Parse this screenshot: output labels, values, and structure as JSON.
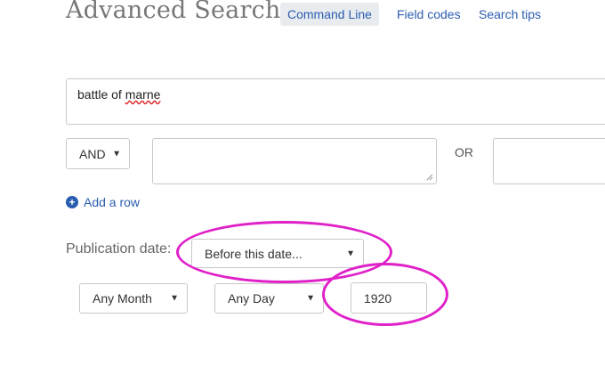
{
  "header": {
    "title": "Advanced Search",
    "tabs": [
      {
        "label": "Command Line",
        "active": true
      },
      {
        "label": "Field codes",
        "active": false
      },
      {
        "label": "Search tips",
        "active": false
      }
    ]
  },
  "query": {
    "row1_text_prefix": "battle of ",
    "row1_text_misspelled": "marne",
    "row2_operator": "AND",
    "row2_value": "",
    "or_label": "OR"
  },
  "add_row_label": "Add a row",
  "publication_date": {
    "label": "Publication date:",
    "mode": "Before this date...",
    "month": "Any Month",
    "day": "Any Day",
    "year": "1920"
  },
  "colors": {
    "accent": "#2a5db0",
    "annotation": "#e020c8"
  },
  "icons": {
    "caret": "caret-down-icon",
    "add": "plus-circle-icon",
    "resize": "resize-handle-icon"
  }
}
